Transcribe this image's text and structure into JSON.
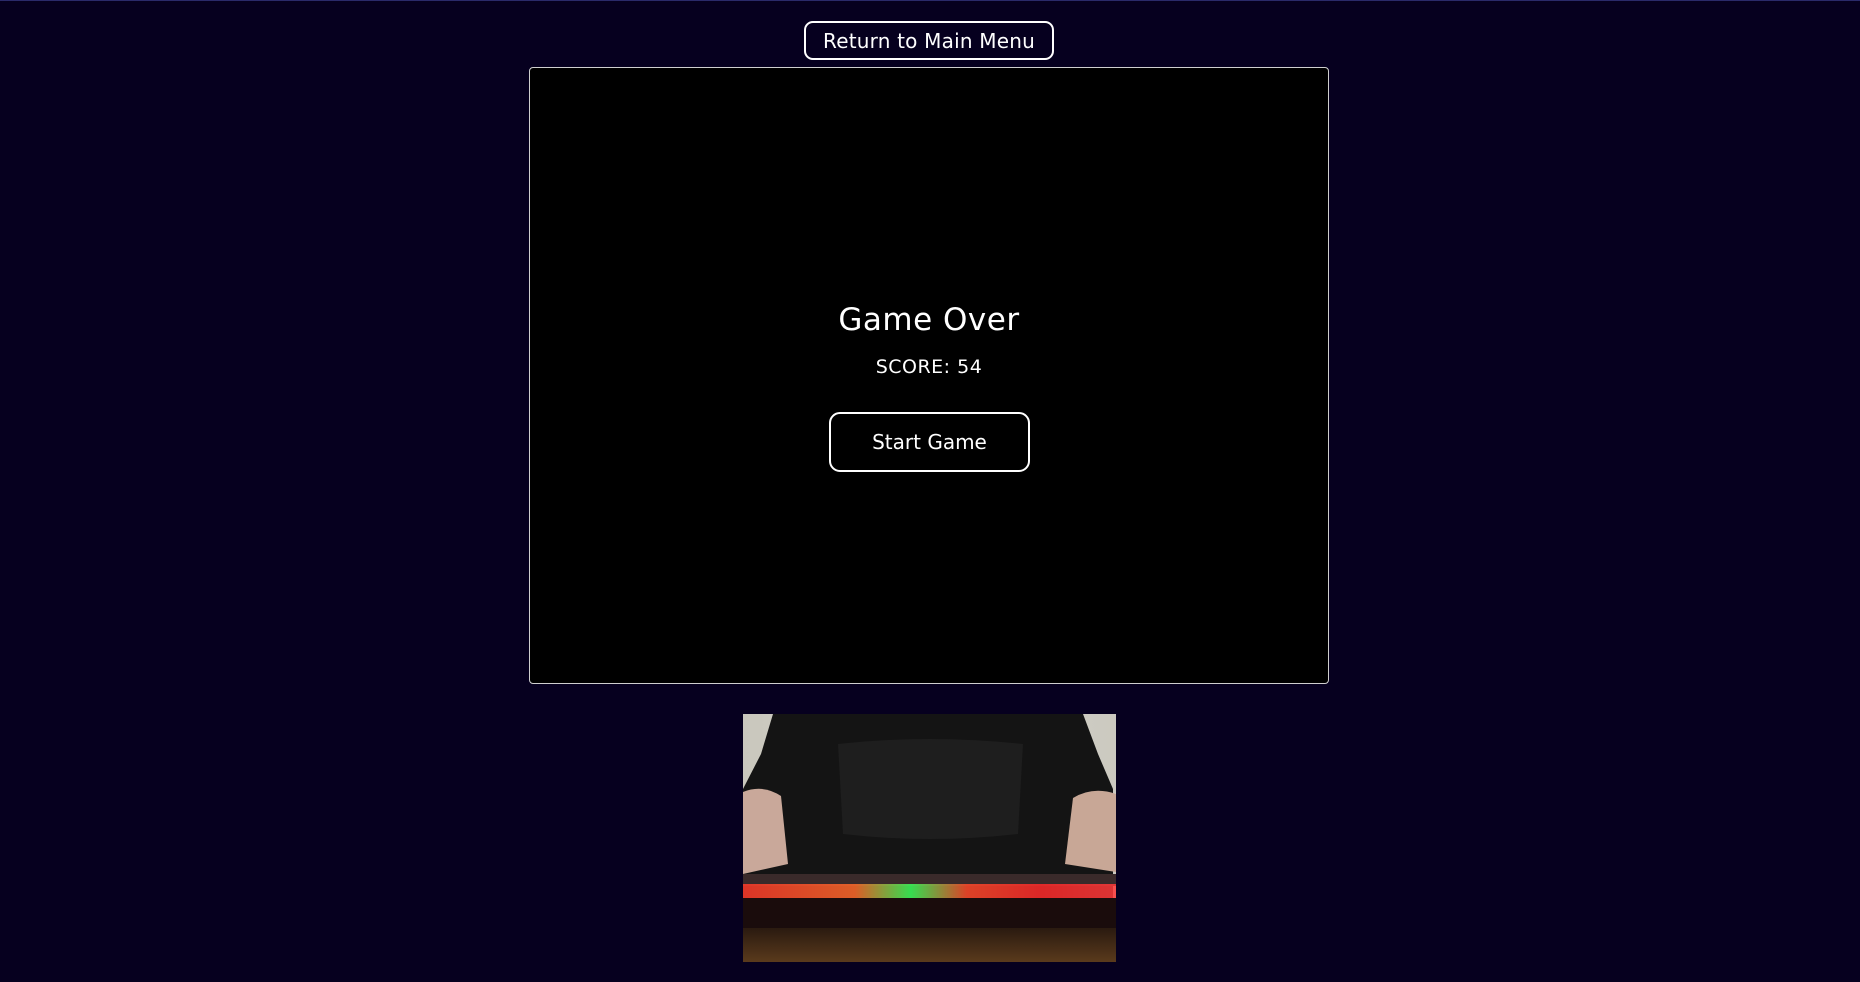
{
  "nav": {
    "return_label": "Return to Main Menu"
  },
  "game": {
    "title": "Game Over",
    "score_text": "SCORE: 54",
    "start_label": "Start Game"
  },
  "webcam": {
    "description_icon": "webcam-feed"
  },
  "colors": {
    "background": "#06001f",
    "canvas": "#000000",
    "border": "#ffffff"
  }
}
